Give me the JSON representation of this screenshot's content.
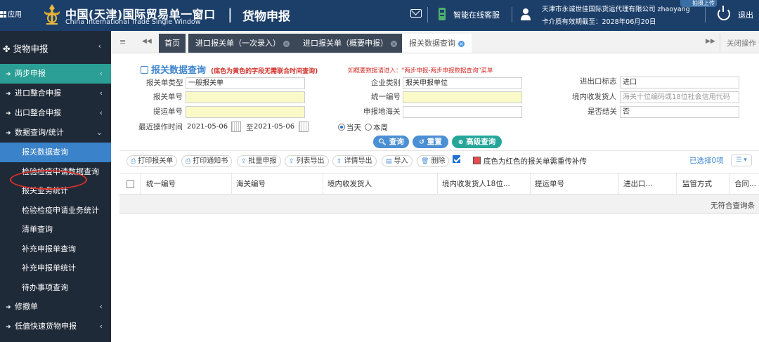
{
  "header": {
    "apps_label": "应用",
    "title_cn": "中国(天津)国际贸易单一窗口",
    "title_en": "China International Trade Single Window",
    "separator": "|",
    "module": "货物申报",
    "online_service": "智能在线客服",
    "company": "天津市永诚世佳国际货运代理有限公司 zhaoyang",
    "card_validity": "卡介质有效期截至：2028年06月20日",
    "upload_label": "拍摄上传",
    "logout": "退出"
  },
  "sidebar": {
    "top": {
      "label": "货物申报",
      "arrow": "‹"
    },
    "groups": [
      {
        "label": "两步申报",
        "arrow": "‹",
        "active": true
      },
      {
        "label": "进口整合申报",
        "arrow": "‹"
      },
      {
        "label": "出口整合申报",
        "arrow": "‹"
      },
      {
        "label": "数据查询/统计",
        "arrow": "⌄"
      }
    ],
    "subs": [
      {
        "label": "报关数据查询",
        "active": true
      },
      {
        "label": "检验检疫申请数据查询"
      },
      {
        "label": "报关业务统计"
      },
      {
        "label": "检验检疫申请业务统计"
      },
      {
        "label": "清单查询"
      },
      {
        "label": "补充申报单查询"
      },
      {
        "label": "补充申报单统计"
      },
      {
        "label": "待办事项查询"
      }
    ],
    "bottom": [
      {
        "label": "修撤单",
        "arrow": "‹"
      },
      {
        "label": "低值快速货物申报",
        "arrow": "‹"
      }
    ]
  },
  "tabs": {
    "menu_icon": "≡",
    "prev": "◀◀",
    "next": "▶▶",
    "items": [
      {
        "label": "首页"
      },
      {
        "label": "进口报关单（一次录入）",
        "close": "×"
      },
      {
        "label": "进口报关单（概要申报）",
        "close": "×"
      },
      {
        "label": "报关数据查询",
        "close": "×"
      }
    ],
    "close_ops": "关闭操作 ▾"
  },
  "form": {
    "title": "报关数据查询",
    "note": "(底色为黄色的字段无需联合时间查询)",
    "hint": "如概要数据请进入：\"两步申报-两步申报数据查询\"菜单",
    "fields": {
      "decl_type": {
        "label": "报关单类型",
        "value": "一般报关单"
      },
      "enterprise_type": {
        "label": "企业类别",
        "value": "报关申报单位"
      },
      "ie_flag": {
        "label": "进出口标志",
        "value": "进口"
      },
      "decl_no": {
        "label": "报关单号",
        "value": ""
      },
      "unified_no": {
        "label": "统一编号",
        "value": ""
      },
      "consignee": {
        "label": "境内收发货人",
        "placeholder": "海关十位编码或18位社会信用代码"
      },
      "bl_no": {
        "label": "提运单号",
        "value": ""
      },
      "decl_customs": {
        "label": "申报地海关",
        "value": ""
      },
      "cleared": {
        "label": "是否结关",
        "value": "否"
      },
      "last_op_time": {
        "label": "最近操作时间",
        "from": "2021-05-06",
        "to_label": "至",
        "to": "2021-05-06"
      }
    },
    "radio": {
      "today": "当天",
      "week": "本周"
    },
    "buttons": {
      "query": "查询",
      "reset": "重置",
      "advanced": "高级查询"
    }
  },
  "toolbar": {
    "print_decl": "打印报关单",
    "print_notice": "打印通知书",
    "batch_declare": "批量申报",
    "export_list": "列表导出",
    "export_detail": "详情导出",
    "import": "导入",
    "delete": "删除",
    "red_note": "底色为红色的报关单需重传补传",
    "selected": "已选择0项",
    "columns_icon": "☰ ▾"
  },
  "table": {
    "headers": [
      "统一编号",
      "海关编号",
      "境内收发货人",
      "境内收发货人18位...",
      "提运单号",
      "进出口...",
      "监管方式",
      "合同..."
    ],
    "empty": "无符合查询条"
  },
  "colors": {
    "header_bg": "#1c3f6a",
    "sidebar_bg": "#1f2a38",
    "active_group": "#2b9f96",
    "active_item": "#3a82c9",
    "accent": "#3d84cf",
    "required_yellow": "#fafac8",
    "warning_red": "#d0312b"
  }
}
